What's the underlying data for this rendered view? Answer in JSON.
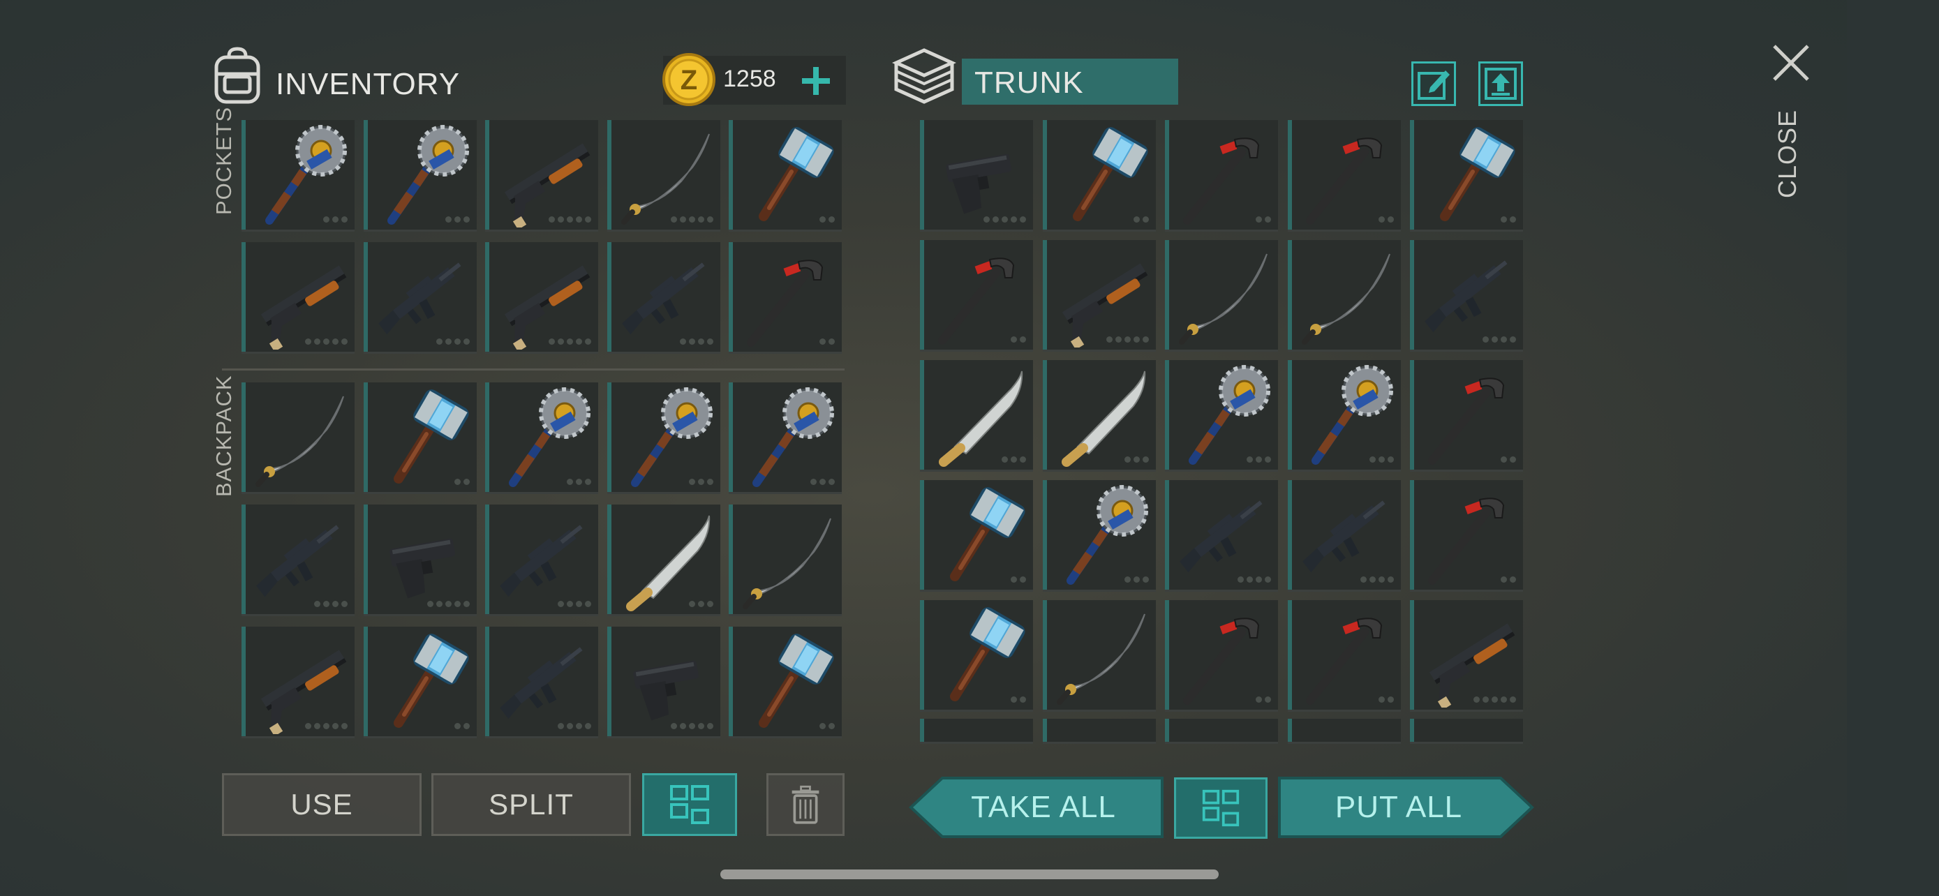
{
  "inventory": {
    "title": "INVENTORY",
    "coins": "1258",
    "pockets_label": "POCKETS",
    "backpack_label": "BACKPACK",
    "pockets": [
      {
        "item": "spiked-mace",
        "dots": 3
      },
      {
        "item": "spiked-mace",
        "dots": 3
      },
      {
        "item": "shotgun",
        "dots": 5
      },
      {
        "item": "katana",
        "dots": 5
      },
      {
        "item": "sledgehammer",
        "dots": 2
      },
      {
        "item": "shotgun",
        "dots": 5
      },
      {
        "item": "assault-rifle",
        "dots": 4
      },
      {
        "item": "shotgun",
        "dots": 5
      },
      {
        "item": "assault-rifle",
        "dots": 4
      },
      {
        "item": "claw-hammer",
        "dots": 2
      }
    ],
    "backpack": [
      {
        "item": "katana",
        "dots": 0
      },
      {
        "item": "sledgehammer",
        "dots": 2
      },
      {
        "item": "spiked-mace",
        "dots": 3
      },
      {
        "item": "spiked-mace",
        "dots": 3
      },
      {
        "item": "spiked-mace",
        "dots": 3
      },
      {
        "item": "assault-rifle",
        "dots": 4
      },
      {
        "item": "pistol",
        "dots": 5
      },
      {
        "item": "assault-rifle",
        "dots": 4
      },
      {
        "item": "machete",
        "dots": 3
      },
      {
        "item": "katana",
        "dots": 0
      },
      {
        "item": "shotgun",
        "dots": 5
      },
      {
        "item": "sledgehammer",
        "dots": 2
      },
      {
        "item": "assault-rifle",
        "dots": 4
      },
      {
        "item": "pistol",
        "dots": 5
      },
      {
        "item": "sledgehammer",
        "dots": 2
      }
    ],
    "buttons": {
      "use": "USE",
      "split": "SPLIT"
    }
  },
  "trunk": {
    "title": "TRUNK",
    "slots": [
      {
        "item": "pistol",
        "dots": 5
      },
      {
        "item": "sledgehammer",
        "dots": 2
      },
      {
        "item": "claw-hammer",
        "dots": 2
      },
      {
        "item": "claw-hammer",
        "dots": 2
      },
      {
        "item": "sledgehammer",
        "dots": 2
      },
      {
        "item": "claw-hammer",
        "dots": 2
      },
      {
        "item": "shotgun",
        "dots": 5
      },
      {
        "item": "katana",
        "dots": 0
      },
      {
        "item": "katana",
        "dots": 0
      },
      {
        "item": "assault-rifle",
        "dots": 4
      },
      {
        "item": "machete",
        "dots": 3
      },
      {
        "item": "machete",
        "dots": 3
      },
      {
        "item": "spiked-mace",
        "dots": 3
      },
      {
        "item": "spiked-mace",
        "dots": 3
      },
      {
        "item": "claw-hammer",
        "dots": 2
      },
      {
        "item": "sledgehammer",
        "dots": 2
      },
      {
        "item": "spiked-mace",
        "dots": 3
      },
      {
        "item": "assault-rifle",
        "dots": 4
      },
      {
        "item": "assault-rifle",
        "dots": 4
      },
      {
        "item": "claw-hammer",
        "dots": 2
      },
      {
        "item": "sledgehammer",
        "dots": 2
      },
      {
        "item": "katana",
        "dots": 0
      },
      {
        "item": "claw-hammer",
        "dots": 2
      },
      {
        "item": "claw-hammer",
        "dots": 2
      },
      {
        "item": "shotgun",
        "dots": 5
      }
    ],
    "buttons": {
      "take_all": "TAKE ALL",
      "put_all": "PUT ALL"
    }
  },
  "close_label": "CLOSE",
  "colors": {
    "accent": "#2f8583",
    "accent_light": "#38b8b0",
    "slot_bg": "#2a2e2c",
    "coin": "#e0b020"
  }
}
